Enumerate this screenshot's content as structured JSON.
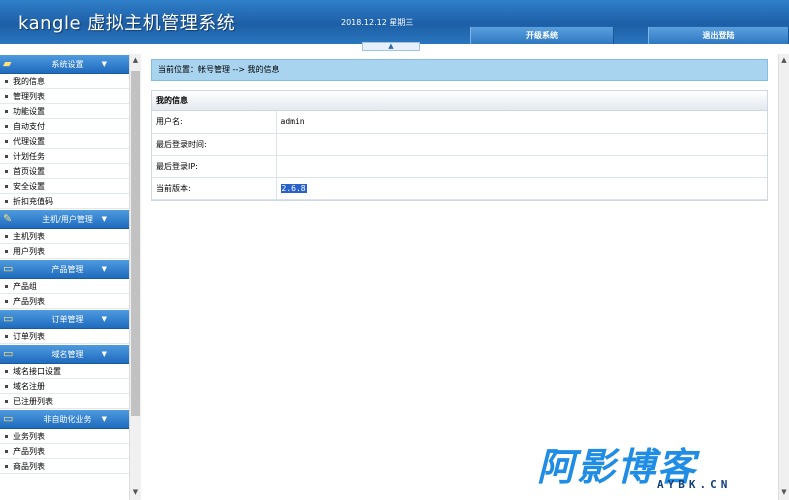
{
  "header": {
    "title": "kangle 虚拟主机管理系统",
    "date": "2018.12.12  星期三",
    "admin_button": "开级系统",
    "logout_button": "退出登陆",
    "toggle_glyph": "▲"
  },
  "sidebar": {
    "groups": [
      {
        "label": "系统设置",
        "icon": "folder-icon",
        "items": [
          "我的信息",
          "管理列表",
          "功能设置",
          "自动支付",
          "代理设置",
          "计划任务",
          "首页设置",
          "安全设置",
          "折扣充值码"
        ]
      },
      {
        "label": "主机/用户管理",
        "icon": "tools-icon",
        "items": [
          "主机列表",
          "用户列表"
        ]
      },
      {
        "label": "产品管理",
        "icon": "monitor-icon",
        "items": [
          "产品组",
          "产品列表"
        ]
      },
      {
        "label": "订单管理",
        "icon": "monitor-icon",
        "items": [
          "订单列表"
        ]
      },
      {
        "label": "域名管理",
        "icon": "monitor-icon",
        "items": [
          "域名接口设置",
          "域名注册",
          "已注册列表"
        ]
      },
      {
        "label": "非自助化业务",
        "icon": "monitor-icon",
        "items": [
          "业务列表",
          "产品列表",
          "商品列表"
        ]
      }
    ]
  },
  "main": {
    "breadcrumb": "当前位置：帐号管理 --> 我的信息",
    "info": {
      "caption": "我的信息",
      "rows": [
        {
          "label": "用户名:",
          "value": "admin"
        },
        {
          "label": "最后登录时间:",
          "value": ""
        },
        {
          "label": "最后登录IP:",
          "value": ""
        },
        {
          "label": "当前版本:",
          "value": "2.6.8"
        }
      ]
    }
  },
  "watermark": {
    "big": "阿影博客",
    "small": "AYBK.CN"
  },
  "colors": {
    "header": "#1d5fa6",
    "breadcrumb": "#a9d4ef",
    "menu_head": "#2f7fc9",
    "selection": "#2a62c9"
  }
}
